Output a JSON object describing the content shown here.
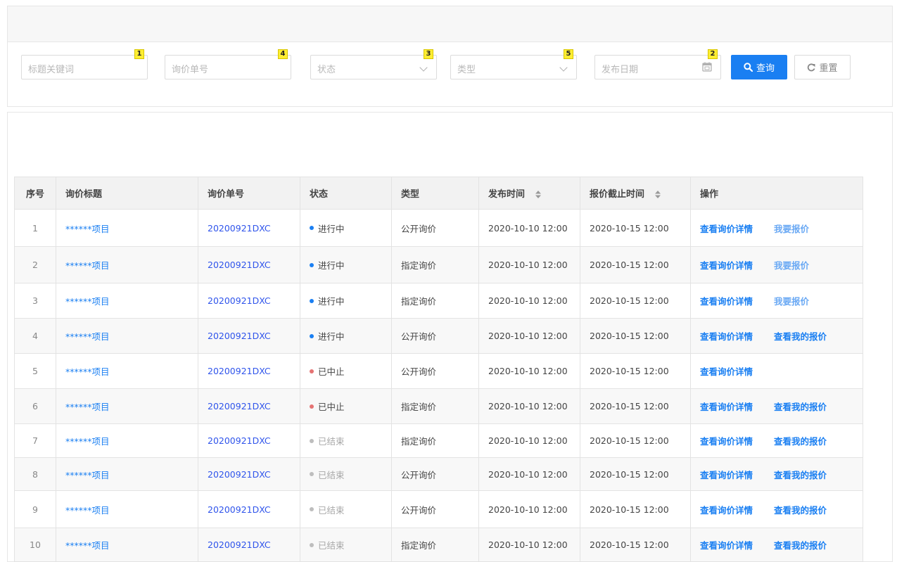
{
  "filters": {
    "keyword": {
      "placeholder": "标题关键词",
      "badge": "1"
    },
    "order_no": {
      "placeholder": "询价单号",
      "badge": "4"
    },
    "status": {
      "placeholder": "状态",
      "badge": "3"
    },
    "type": {
      "placeholder": "类型",
      "badge": "5"
    },
    "publish_date": {
      "placeholder": "发布日期",
      "badge": "2"
    },
    "search_label": "查询",
    "reset_label": "重置"
  },
  "table": {
    "columns": [
      "序号",
      "询价标题",
      "询价单号",
      "状态",
      "类型",
      "发布时间",
      "报价截止时间",
      "操作"
    ],
    "rows": [
      {
        "idx": "1",
        "title": "******项目",
        "order": "20200921DXC",
        "status": "进行中",
        "status_color": "#1a7ff2",
        "type": "公开询价",
        "publish": "2020-10-10 12:00",
        "deadline": "2020-10-15 12:00",
        "op1": "查看询价详情",
        "op2": "我要报价"
      },
      {
        "idx": "2",
        "title": "******项目",
        "order": "20200921DXC",
        "status": "进行中",
        "status_color": "#1a7ff2",
        "type": "指定询价",
        "publish": "2020-10-10 12:00",
        "deadline": "2020-10-15 12:00",
        "op1": "查看询价详情",
        "op2": "我要报价"
      },
      {
        "idx": "3",
        "title": "******项目",
        "order": "20200921DXC",
        "status": "进行中",
        "status_color": "#1a7ff2",
        "type": "指定询价",
        "publish": "2020-10-10 12:00",
        "deadline": "2020-10-15 12:00",
        "op1": "查看询价详情",
        "op2": "我要报价"
      },
      {
        "idx": "4",
        "title": "******项目",
        "order": "20200921DXC",
        "status": "进行中",
        "status_color": "#1a7ff2",
        "type": "公开询价",
        "publish": "2020-10-10 12:00",
        "deadline": "2020-10-15 12:00",
        "op1": "查看询价详情",
        "op2": "查看我的报价"
      },
      {
        "idx": "5",
        "title": "******项目",
        "order": "20200921DXC",
        "status": "已中止",
        "status_color": "#e57373",
        "type": "公开询价",
        "publish": "2020-10-10 12:00",
        "deadline": "2020-10-15 12:00",
        "op1": "查看询价详情",
        "op2": ""
      },
      {
        "idx": "6",
        "title": "******项目",
        "order": "20200921DXC",
        "status": "已中止",
        "status_color": "#e57373",
        "type": "指定询价",
        "publish": "2020-10-10 12:00",
        "deadline": "2020-10-15 12:00",
        "op1": "查看询价详情",
        "op2": "查看我的报价"
      },
      {
        "idx": "7",
        "title": "******项目",
        "order": "20200921DXC",
        "status": "已结束",
        "status_color": "#bdbdbd",
        "type": "指定询价",
        "publish": "2020-10-10 12:00",
        "deadline": "2020-10-15 12:00",
        "op1": "查看询价详情",
        "op2": "查看我的报价"
      },
      {
        "idx": "8",
        "title": "******项目",
        "order": "20200921DXC",
        "status": "已结束",
        "status_color": "#bdbdbd",
        "type": "公开询价",
        "publish": "2020-10-10 12:00",
        "deadline": "2020-10-15 12:00",
        "op1": "查看询价详情",
        "op2": "查看我的报价"
      },
      {
        "idx": "9",
        "title": "******项目",
        "order": "20200921DXC",
        "status": "已结束",
        "status_color": "#bdbdbd",
        "type": "公开询价",
        "publish": "2020-10-10 12:00",
        "deadline": "2020-10-15 12:00",
        "op1": "查看询价详情",
        "op2": "查看我的报价"
      },
      {
        "idx": "10",
        "title": "******项目",
        "order": "20200921DXC",
        "status": "已结束",
        "status_color": "#bdbdbd",
        "type": "指定询价",
        "publish": "2020-10-10 12:00",
        "deadline": "2020-10-15 12:00",
        "op1": "查看询价详情",
        "op2": "查看我的报价"
      }
    ]
  }
}
